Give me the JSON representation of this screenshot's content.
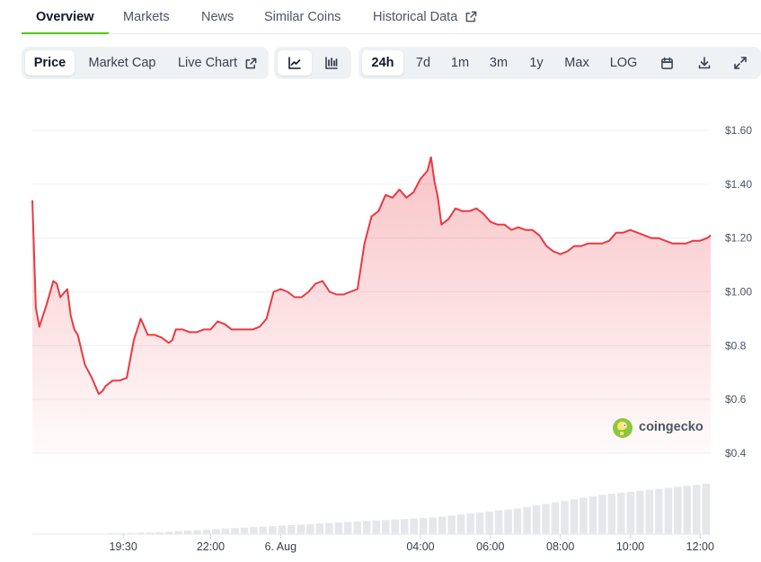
{
  "tabs": [
    {
      "label": "Overview",
      "active": true
    },
    {
      "label": "Markets"
    },
    {
      "label": "News"
    },
    {
      "label": "Similar Coins"
    },
    {
      "label": "Historical Data",
      "external": true
    }
  ],
  "toolbar": {
    "metric_buttons": [
      {
        "label": "Price",
        "active": true
      },
      {
        "label": "Market Cap"
      },
      {
        "label": "Live Chart",
        "external": true
      }
    ],
    "chart_type_buttons": [
      {
        "icon": "line-chart-icon",
        "active": true
      },
      {
        "icon": "candlestick-icon"
      }
    ],
    "range_buttons": [
      {
        "label": "24h",
        "active": true
      },
      {
        "label": "7d"
      },
      {
        "label": "1m"
      },
      {
        "label": "3m"
      },
      {
        "label": "1y"
      },
      {
        "label": "Max"
      },
      {
        "label": "LOG"
      }
    ],
    "icon_buttons": [
      {
        "icon": "calendar-icon"
      },
      {
        "icon": "download-icon"
      },
      {
        "icon": "fullscreen-icon"
      }
    ]
  },
  "watermark": {
    "text": "coingecko"
  },
  "colors": {
    "line": "#ea3943",
    "accent": "#4bcc00",
    "volume": "#e5e7eb"
  },
  "chart_data": {
    "type": "area",
    "y_tick_labels": [
      "$0.4",
      "$0.6",
      "$0.8",
      "$1.00",
      "$1.20",
      "$1.40",
      "$1.60"
    ],
    "y_ticks": [
      0.4,
      0.6,
      0.8,
      1.0,
      1.2,
      1.4,
      1.6
    ],
    "ylim": [
      0.4,
      1.6
    ],
    "x_tick_labels": [
      "19:30",
      "22:00",
      "6. Aug",
      "04:00",
      "06:00",
      "08:00",
      "10:00",
      "12:00"
    ],
    "x_ticks_hours": [
      19.5,
      22.0,
      24.0,
      28.0,
      30.0,
      32.0,
      34.0,
      36.0
    ],
    "x_range_hours": [
      16.9,
      36.3
    ],
    "grid": true,
    "series": [
      {
        "x_hours": [
          16.9,
          17.0,
          17.1,
          17.3,
          17.5,
          17.6,
          17.7,
          17.9,
          18.0,
          18.1,
          18.2,
          18.4,
          18.6,
          18.8,
          18.9,
          19.0,
          19.2,
          19.4,
          19.6,
          19.8,
          20.0,
          20.2,
          20.4,
          20.6,
          20.8,
          20.9,
          21.0,
          21.2,
          21.4,
          21.6,
          21.8,
          22.0,
          22.2,
          22.4,
          22.6,
          22.8,
          23.0,
          23.2,
          23.4,
          23.6,
          23.8,
          24.0,
          24.2,
          24.4,
          24.6,
          24.8,
          25.0,
          25.2,
          25.4,
          25.6,
          25.8,
          26.0,
          26.2,
          26.4,
          26.6,
          26.8,
          27.0,
          27.2,
          27.4,
          27.6,
          27.8,
          28.0,
          28.2,
          28.3,
          28.4,
          28.5,
          28.6,
          28.8,
          29.0,
          29.2,
          29.4,
          29.6,
          29.8,
          30.0,
          30.2,
          30.4,
          30.6,
          30.8,
          31.0,
          31.2,
          31.4,
          31.6,
          31.8,
          32.0,
          32.2,
          32.4,
          32.6,
          32.8,
          33.0,
          33.2,
          33.4,
          33.6,
          33.8,
          34.0,
          34.2,
          34.4,
          34.6,
          34.8,
          35.0,
          35.2,
          35.4,
          35.6,
          35.8,
          36.0,
          36.2,
          36.3
        ],
        "values": [
          1.34,
          0.94,
          0.87,
          0.95,
          1.04,
          1.03,
          0.98,
          1.01,
          0.91,
          0.86,
          0.84,
          0.73,
          0.68,
          0.62,
          0.63,
          0.65,
          0.67,
          0.67,
          0.68,
          0.82,
          0.9,
          0.84,
          0.84,
          0.83,
          0.81,
          0.82,
          0.86,
          0.86,
          0.85,
          0.85,
          0.86,
          0.86,
          0.89,
          0.88,
          0.86,
          0.86,
          0.86,
          0.86,
          0.87,
          0.9,
          1.0,
          1.01,
          1.0,
          0.98,
          0.98,
          1.0,
          1.03,
          1.04,
          1.0,
          0.99,
          0.99,
          1.0,
          1.01,
          1.18,
          1.28,
          1.3,
          1.36,
          1.35,
          1.38,
          1.35,
          1.37,
          1.42,
          1.45,
          1.5,
          1.41,
          1.35,
          1.25,
          1.27,
          1.31,
          1.3,
          1.3,
          1.31,
          1.29,
          1.26,
          1.25,
          1.25,
          1.23,
          1.24,
          1.23,
          1.23,
          1.21,
          1.17,
          1.15,
          1.14,
          1.15,
          1.17,
          1.17,
          1.18,
          1.18,
          1.18,
          1.19,
          1.22,
          1.22,
          1.23,
          1.22,
          1.21,
          1.2,
          1.2,
          1.19,
          1.18,
          1.18,
          1.18,
          1.19,
          1.19,
          1.2,
          1.21
        ]
      }
    ],
    "volume": {
      "relative_values": [
        0.01,
        0.01,
        0.01,
        0.01,
        0.01,
        0.01,
        0.01,
        0.01,
        0.02,
        0.02,
        0.02,
        0.03,
        0.03,
        0.04,
        0.05,
        0.06,
        0.07,
        0.08,
        0.09,
        0.1,
        0.11,
        0.12,
        0.13,
        0.14,
        0.15,
        0.16,
        0.17,
        0.18,
        0.19,
        0.2,
        0.21,
        0.22,
        0.23,
        0.24,
        0.25,
        0.26,
        0.27,
        0.28,
        0.29,
        0.3,
        0.31,
        0.32,
        0.33,
        0.35,
        0.37,
        0.39,
        0.41,
        0.43,
        0.45,
        0.47,
        0.49,
        0.51,
        0.54,
        0.57,
        0.6,
        0.63,
        0.66,
        0.69,
        0.72,
        0.75,
        0.78,
        0.8,
        0.82,
        0.84,
        0.86,
        0.88,
        0.9,
        0.92,
        0.94,
        0.96,
        0.98,
        1.0
      ]
    }
  }
}
